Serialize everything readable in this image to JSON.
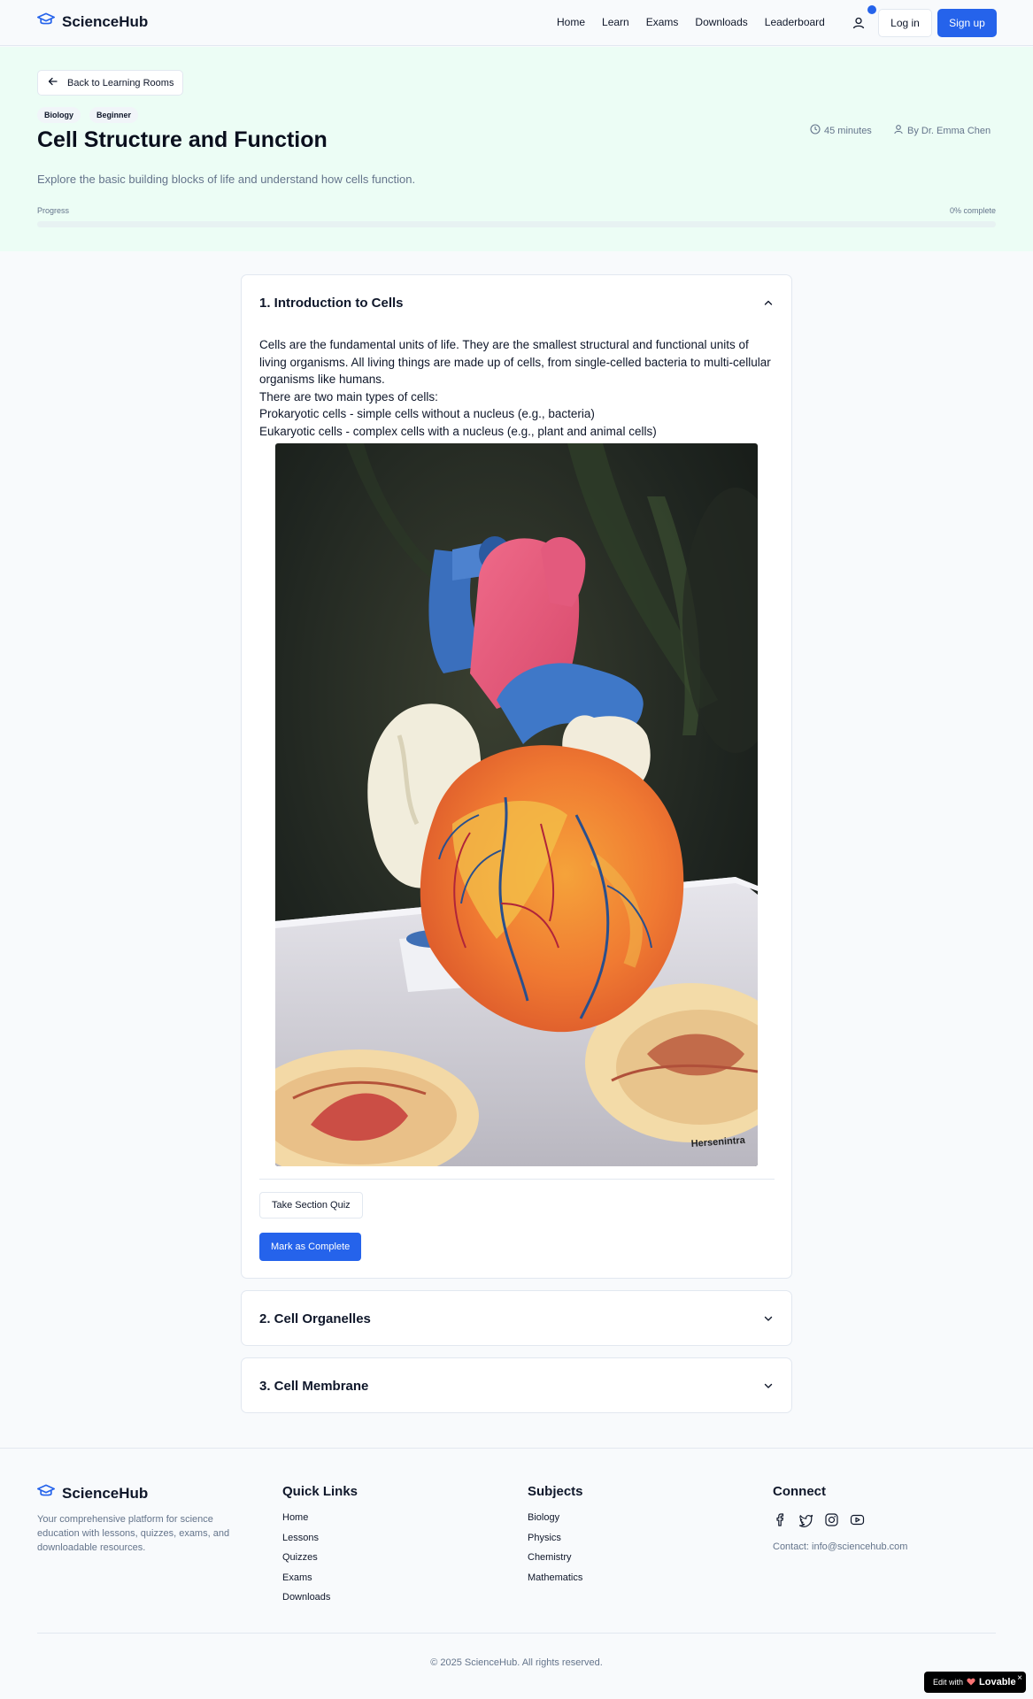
{
  "header": {
    "brand": "ScienceHub",
    "nav": [
      "Home",
      "Learn",
      "Exams",
      "Downloads",
      "Leaderboard"
    ],
    "login": "Log in",
    "signup": "Sign up",
    "accent_color": "#2563eb",
    "brand_icon": "graduation-cap-icon",
    "user_icon": "user-icon"
  },
  "lesson": {
    "back": "Back to Learning Rooms",
    "tags": [
      "Biology",
      "Beginner"
    ],
    "title": "Cell Structure and Function",
    "description": "Explore the basic building blocks of life and understand how cells function.",
    "duration": "45 minutes",
    "author": "By Dr. Emma Chen",
    "progress_label": "Progress",
    "progress_text": "0% complete",
    "progress_value": 0
  },
  "sections": [
    {
      "title": "1. Introduction to Cells",
      "expanded": true,
      "paragraphs": [
        "Cells are the fundamental units of life. They are the smallest structural and functional units of living organisms. All living things are made up of cells, from single-celled bacteria to multi-cellular organisms like humans.",
        "There are two main types of cells:",
        "Prokaryotic cells - simple cells without a nucleus (e.g., bacteria)",
        "Eukaryotic cells - complex cells with a nucleus (e.g., plant and animal cells)"
      ],
      "image_text": "Hersenintra",
      "quiz": "Take Section Quiz",
      "complete": "Mark as Complete"
    },
    {
      "title": "2. Cell Organelles",
      "expanded": false
    },
    {
      "title": "3. Cell Membrane",
      "expanded": false
    }
  ],
  "footer": {
    "brand": "ScienceHub",
    "description": "Your comprehensive platform for science education with lessons, quizzes, exams, and downloadable resources.",
    "quick_links_title": "Quick Links",
    "quick_links": [
      "Home",
      "Lessons",
      "Quizzes",
      "Exams",
      "Downloads"
    ],
    "subjects_title": "Subjects",
    "subjects": [
      "Biology",
      "Physics",
      "Chemistry",
      "Mathematics"
    ],
    "connect_title": "Connect",
    "social_icons": [
      "facebook-icon",
      "twitter-icon",
      "instagram-icon",
      "youtube-icon"
    ],
    "contact": "Contact: info@sciencehub.com",
    "copyright": "© 2025 ScienceHub. All rights reserved."
  },
  "badge": {
    "prefix": "Edit with",
    "name": "Lovable",
    "close": "×"
  }
}
